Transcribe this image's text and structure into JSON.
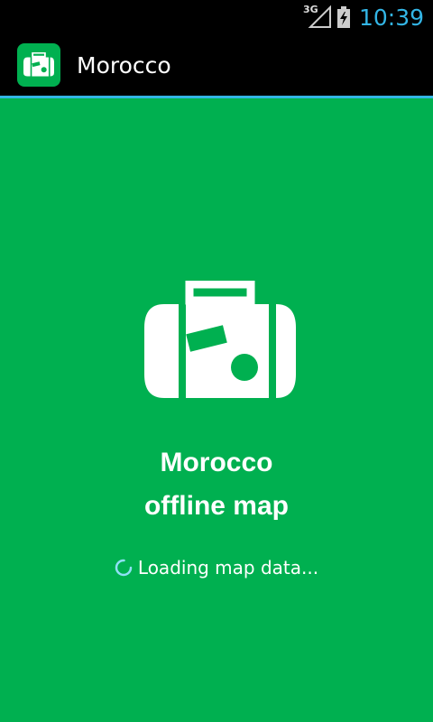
{
  "status_bar": {
    "network": "3G",
    "clock": "10:39",
    "icons": [
      "signal-icon",
      "battery-charging-icon"
    ]
  },
  "action_bar": {
    "title": "Morocco",
    "icon": "suitcase-icon"
  },
  "splash": {
    "title_line1": "Morocco",
    "title_line2": "offline map",
    "loading_text": "Loading map data...",
    "icon": "suitcase-icon"
  },
  "colors": {
    "brand": "#00b050",
    "accent": "#33b5e5",
    "background": "#000000"
  }
}
